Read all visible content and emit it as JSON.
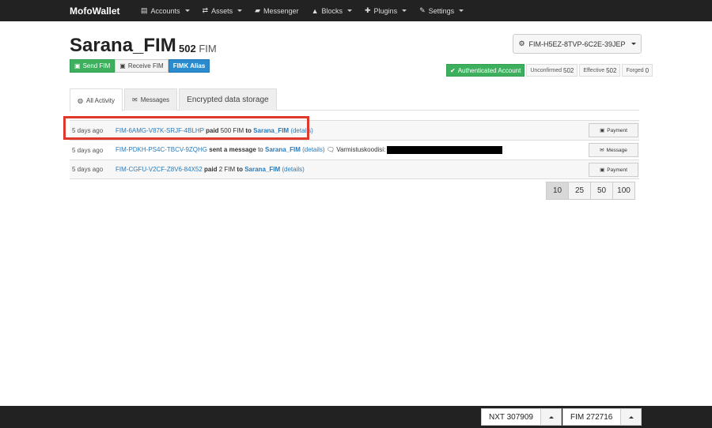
{
  "nav": {
    "brand": "MofoWallet",
    "items": [
      {
        "icon": "wallet-icon",
        "glyph": "▤",
        "label": "Accounts",
        "dropdown": true
      },
      {
        "icon": "exchange-icon",
        "glyph": "⇄",
        "label": "Assets",
        "dropdown": true
      },
      {
        "icon": "chat-icon",
        "glyph": "▰",
        "label": "Messenger",
        "dropdown": false
      },
      {
        "icon": "road-icon",
        "glyph": "▲",
        "label": "Blocks",
        "dropdown": true
      },
      {
        "icon": "puzzle-icon",
        "glyph": "✚",
        "label": "Plugins",
        "dropdown": true
      },
      {
        "icon": "wrench-icon",
        "glyph": "✎",
        "label": "Settings",
        "dropdown": true
      }
    ]
  },
  "account": {
    "name": "Sarana_FIM",
    "balance": "502",
    "unit": "FIM",
    "address": "FIM-H5EZ-8TVP-6C2E-39JEP"
  },
  "buttons": {
    "send": "Send FIM",
    "receive": "Receive FIM",
    "alias": "FIMK Alias"
  },
  "status": {
    "authenticated": "Authenticated Account",
    "unconfirmed_label": "Unconfirmed",
    "unconfirmed": "502",
    "effective_label": "Effective",
    "effective": "502",
    "forged_label": "Forged",
    "forged": "0"
  },
  "tabs": {
    "all": "All Activity",
    "messages": "Messages",
    "encrypted": "Encrypted data storage"
  },
  "activity": [
    {
      "time": "5 days ago",
      "from": "FIM-6AMG-V87K-SRJF-4BLHP",
      "verb": "paid",
      "amount": "500 FIM",
      "to_word": "to",
      "to": "Sarana_FIM",
      "details": "(details)",
      "type": "Payment"
    },
    {
      "time": "5 days ago",
      "from": "FIM-PDKH-PS4C-TBCV-9ZQHG",
      "verb": "sent a message",
      "to_word": "to",
      "to": "Sarana_FIM",
      "details": "(details)",
      "message": "Varmistuskoodisi:",
      "type": "Message"
    },
    {
      "time": "5 days ago",
      "from": "FIM-CGFU-V2CF-Z8V6-84X52",
      "verb": "paid",
      "amount": "2 FIM",
      "to_word": "to",
      "to": "Sarana_FIM",
      "details": "(details)",
      "type": "Payment"
    }
  ],
  "pagination": [
    "10",
    "25",
    "50",
    "100"
  ],
  "ticker": {
    "nxt": "NXT  307909",
    "fim": "FIM  272716"
  }
}
